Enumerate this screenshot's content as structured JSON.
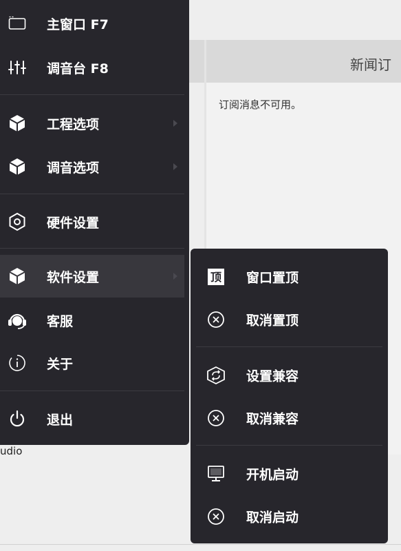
{
  "background": {
    "panel_title": "新闻订",
    "message": "订阅消息不可用。",
    "bottom_text": "udio"
  },
  "menu": {
    "items": [
      {
        "label": "主窗口 F7",
        "icon": "window-icon"
      },
      {
        "label": "调音台 F8",
        "icon": "mixer-icon"
      },
      {
        "label": "工程选项",
        "icon": "cube-icon",
        "has_submenu": true
      },
      {
        "label": "调音选项",
        "icon": "cube-icon",
        "has_submenu": true
      },
      {
        "label": "硬件设置",
        "icon": "hexagon-gear-icon"
      },
      {
        "label": "软件设置",
        "icon": "cube-icon",
        "has_submenu": true,
        "highlighted": true
      },
      {
        "label": "客服",
        "icon": "headset-icon"
      },
      {
        "label": "关于",
        "icon": "info-icon"
      },
      {
        "label": "退出",
        "icon": "power-icon"
      }
    ]
  },
  "submenu": {
    "items": [
      {
        "label": "窗口置顶",
        "icon": "pin-top-icon",
        "icon_text": "顶"
      },
      {
        "label": "取消置顶",
        "icon": "cancel-icon"
      },
      {
        "label": "设置兼容",
        "icon": "compat-icon"
      },
      {
        "label": "取消兼容",
        "icon": "cancel-icon"
      },
      {
        "label": "开机启动",
        "icon": "monitor-icon"
      },
      {
        "label": "取消启动",
        "icon": "cancel-icon"
      }
    ]
  },
  "colors": {
    "menu_bg": "#27262c",
    "highlight_bg": "#38373d",
    "text": "#ffffff"
  }
}
